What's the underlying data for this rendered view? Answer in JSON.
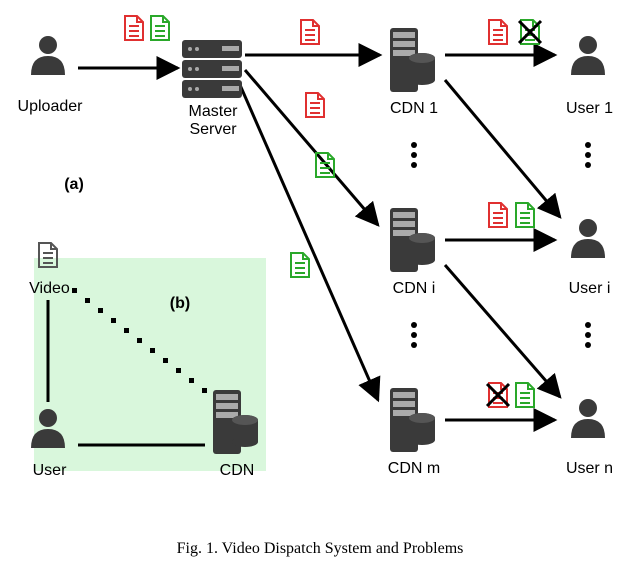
{
  "caption": "Fig. 1.   Video Dispatch System and Problems",
  "labels": {
    "uploader": "Uploader",
    "master_server_l1": "Master",
    "master_server_l2": "Server",
    "cdn1": "CDN 1",
    "cdni": "CDN i",
    "cdnm": "CDN m",
    "user1": "User 1",
    "useri": "User i",
    "usern": "User n",
    "video": "Video",
    "user": "User",
    "cdn": "CDN"
  },
  "panel_a": "(a)",
  "panel_b": "(b)",
  "chart_data": {
    "type": "diagram",
    "title": "Video Dispatch System and Problems",
    "panels": [
      {
        "id": "a",
        "description": "Full dispatch pipeline from Uploader to Master Server to multiple CDNs to Users, with red/green document copies and some crossed (failed) deliveries",
        "nodes": [
          {
            "id": "uploader",
            "label": "Uploader",
            "type": "user"
          },
          {
            "id": "master",
            "label": "Master Server",
            "type": "server"
          },
          {
            "id": "cdn1",
            "label": "CDN 1",
            "type": "cdn"
          },
          {
            "id": "cdni",
            "label": "CDN i",
            "type": "cdn"
          },
          {
            "id": "cdnm",
            "label": "CDN m",
            "type": "cdn"
          },
          {
            "id": "user1",
            "label": "User 1",
            "type": "user"
          },
          {
            "id": "useri",
            "label": "User i",
            "type": "user"
          },
          {
            "id": "usern",
            "label": "User n",
            "type": "user"
          }
        ],
        "edges": [
          {
            "from": "uploader",
            "to": "master",
            "docs": [
              "red",
              "green"
            ]
          },
          {
            "from": "master",
            "to": "cdn1",
            "docs": [
              "red"
            ]
          },
          {
            "from": "master",
            "to": "cdni",
            "docs": [
              "red",
              "green"
            ]
          },
          {
            "from": "master",
            "to": "cdnm",
            "docs": [
              "green"
            ]
          },
          {
            "from": "cdn1",
            "to": "user1",
            "docs": [
              "red",
              "green-crossed"
            ]
          },
          {
            "from": "cdn1",
            "to": "useri"
          },
          {
            "from": "cdni",
            "to": "useri",
            "docs": [
              "red",
              "green"
            ]
          },
          {
            "from": "cdni",
            "to": "usern"
          },
          {
            "from": "cdnm",
            "to": "usern",
            "docs": [
              "red-crossed",
              "green"
            ]
          }
        ]
      },
      {
        "id": "b",
        "description": "Triangle highlighted in green: Video, User, CDN with dotted association between Video and CDN",
        "nodes": [
          {
            "id": "video",
            "label": "Video",
            "type": "document"
          },
          {
            "id": "user_b",
            "label": "User",
            "type": "user"
          },
          {
            "id": "cdn_b",
            "label": "CDN",
            "type": "cdn"
          }
        ],
        "edges": [
          {
            "from": "video",
            "to": "user_b",
            "style": "solid"
          },
          {
            "from": "user_b",
            "to": "cdn_b",
            "style": "solid"
          },
          {
            "from": "video",
            "to": "cdn_b",
            "style": "dotted"
          }
        ]
      }
    ]
  }
}
